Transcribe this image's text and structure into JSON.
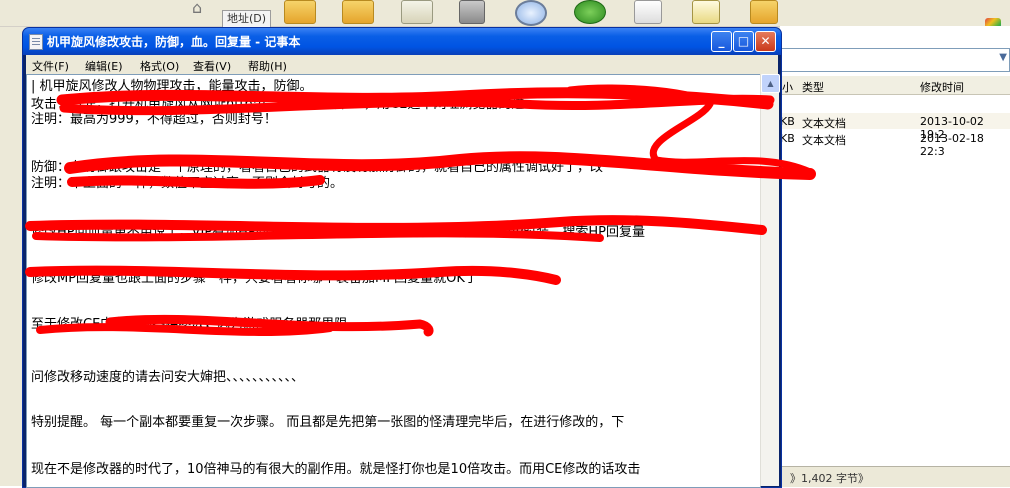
{
  "explorer": {
    "address_label": "地址(D)",
    "columns": {
      "size_tail": "小",
      "type": "类型",
      "modified": "修改时间"
    },
    "files": [
      {
        "size_tail": "KB",
        "type": "文本文档",
        "modified": "2013-10-02 19:2"
      },
      {
        "size_tail": "KB",
        "type": "文本文档",
        "modified": "2013-02-18 22:3"
      }
    ],
    "status_text": "》1,402 字节》"
  },
  "notepad": {
    "title": "机甲旋风修改攻击，防御，血。回复量 - 记事本",
    "menu": [
      "文件(F)",
      "编辑(E)",
      "格式(O)",
      "查看(V)",
      "帮助(H)"
    ],
    "lines": [
      "|                   机甲旋风修改人物物理攻击，能量攻击，防御。",
      "攻击：首先，打开机甲旋风从网址http://...... 然后打开CE，用CE选中网址浏览器的进",
      "注明：最高为999，不得超过，否则封号！",
      "",
      "防御：在防御跟攻击是一个原理的，看看自己的武器有没有加防御的，就看自己的属性调试好了，改",
      "注明：不上面的一样，数值不宜过高，否则会封号的。",
      "",
      "修改HP回血量更不用说了，VIP有加HP回复量的时装把，就重复上面的步骤，脱下VIP时装，搜索HP回复量",
      "",
      "修改MP回复量也跟上面的步骤一样，只要看看你哪个装备加MP回复量就OK了",
      "",
      "至于修改CE中游戏的各种参数，因为游戏服务器那里限。",
      "",
      "问修改移动速度的请去问安大婶把、、、、、、、、、、、",
      "",
      "特别提醒。 每一个副本都要重复一次步骤。 而且都是先把第一张图的怪清理完毕后，在进行修改的，下",
      "",
      "现在不是修改器的时代了，10倍神马的有很大的副作用。就是怪打你也是10倍攻击。而用CE修改的话攻击"
    ]
  },
  "colors": {
    "scribble": "#ff0000",
    "title_bar": "#0054e3",
    "window_bg": "#ece9d8"
  }
}
